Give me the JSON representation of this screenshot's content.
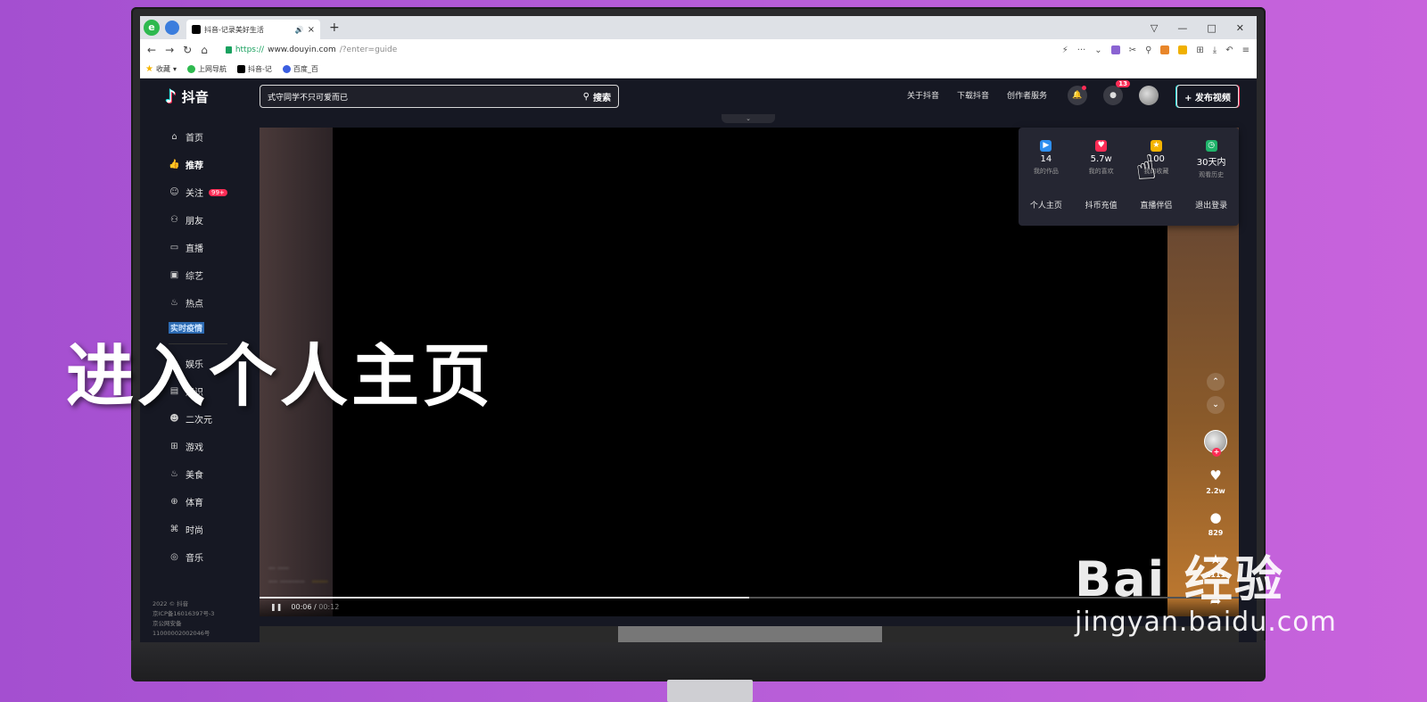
{
  "browser": {
    "tab_title": "抖音-记录美好生活",
    "url_scheme": "https://",
    "url_host": "www.douyin.com",
    "url_path": "/?enter=guide",
    "bookmarks": [
      {
        "label": "收藏"
      },
      {
        "label": "上网导航"
      },
      {
        "label": "抖音-记"
      },
      {
        "label": "百度_百"
      }
    ]
  },
  "app": {
    "logo_text": "抖音",
    "search_query": "式守同学不只可爱而已",
    "search_button": "搜索",
    "nav_links": [
      "关于抖音",
      "下载抖音",
      "创作者服务"
    ],
    "message_badge": "13",
    "publish_label": "+ 发布视频",
    "sidebar": [
      {
        "label": "首页",
        "icon": "home-icon",
        "glyph": "⌂"
      },
      {
        "label": "推荐",
        "icon": "thumb-up-icon",
        "glyph": "👍"
      },
      {
        "label": "关注",
        "icon": "follow-icon",
        "glyph": "☺",
        "badge": "99+"
      },
      {
        "label": "朋友",
        "icon": "friends-icon",
        "glyph": "⚇"
      },
      {
        "label": "直播",
        "icon": "live-icon",
        "glyph": "▭"
      },
      {
        "label": "综艺",
        "icon": "variety-icon",
        "glyph": "▣"
      },
      {
        "label": "热点",
        "icon": "fire-icon",
        "glyph": "♨"
      }
    ],
    "sidebar_special": "实时疫情",
    "sidebar_lower": [
      {
        "label": "娱乐",
        "icon": "entertainment-icon",
        "glyph": "☆"
      },
      {
        "label": "知识",
        "icon": "knowledge-icon",
        "glyph": "▤"
      },
      {
        "label": "二次元",
        "icon": "anime-icon",
        "glyph": "☻"
      },
      {
        "label": "游戏",
        "icon": "game-icon",
        "glyph": "⊞"
      },
      {
        "label": "美食",
        "icon": "food-icon",
        "glyph": "♨"
      },
      {
        "label": "体育",
        "icon": "sports-icon",
        "glyph": "⊕"
      },
      {
        "label": "时尚",
        "icon": "fashion-icon",
        "glyph": "⌘"
      },
      {
        "label": "音乐",
        "icon": "music-icon",
        "glyph": "◎"
      }
    ],
    "footer_lines": [
      "2022 © 抖音",
      "京ICP备16016397号-3",
      "京公网安备",
      "11000002002046号"
    ],
    "player": {
      "time_current": "00:06",
      "time_sep": " / ",
      "time_total": "00:12",
      "progress": 0.5
    },
    "rail": {
      "likes": "2.2w",
      "comments": "829",
      "favorites": "2111"
    },
    "dropdown": {
      "stats": [
        {
          "value": "14",
          "label": "我的作品",
          "icon": "play-icon",
          "color": "#2e8ff0"
        },
        {
          "value": "5.7w",
          "label": "我的喜欢",
          "icon": "heart-icon",
          "color": "#fe2c55"
        },
        {
          "value": "100",
          "label": "我的收藏",
          "icon": "star-icon",
          "color": "#f5b400"
        },
        {
          "value": "30天内",
          "label": "观看历史",
          "icon": "clock-icon",
          "color": "#1fb36a"
        }
      ],
      "menu": [
        "个人主页",
        "抖币充值",
        "直播伴侣",
        "退出登录"
      ]
    }
  },
  "overlay": {
    "title": "进入个人主页",
    "watermark_brand": "Bai 经验",
    "watermark_url": "jingyan.baidu.com"
  },
  "colors": {
    "accent_red": "#fe2c55",
    "accent_cyan": "#25f4ee",
    "app_bg": "#161823"
  }
}
